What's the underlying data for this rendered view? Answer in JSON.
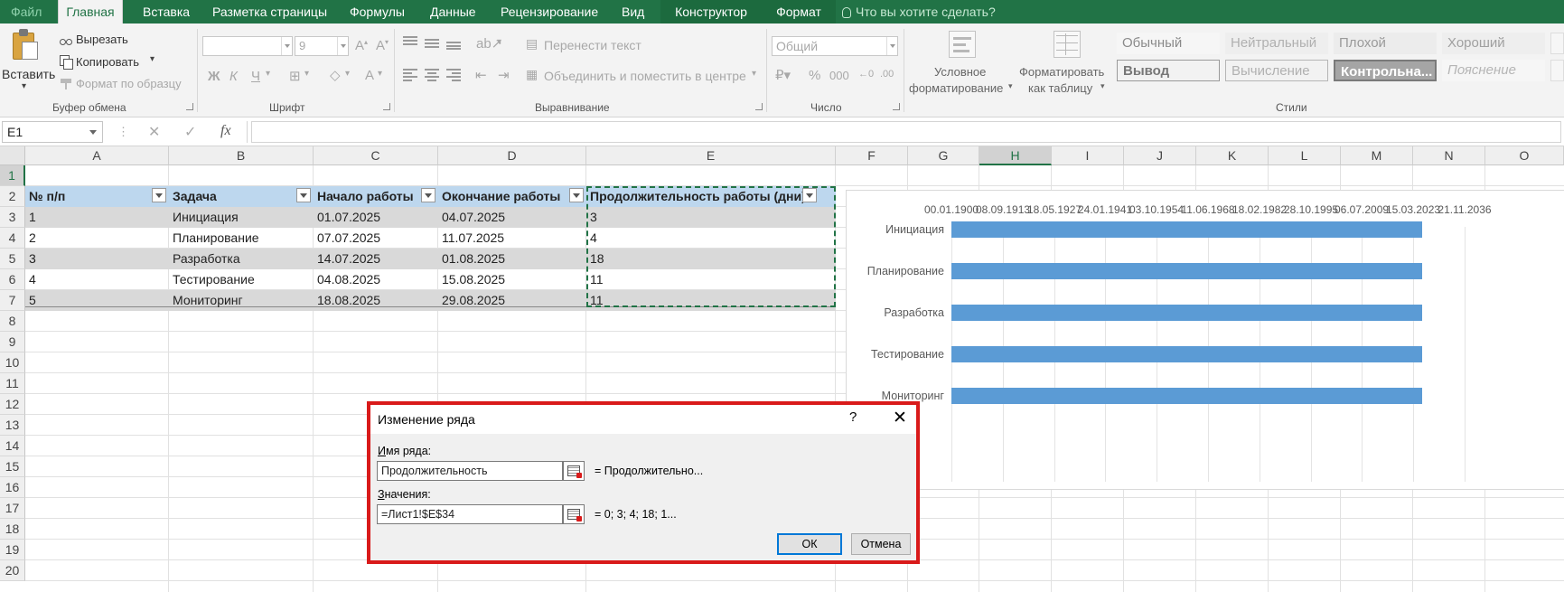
{
  "tabs": [
    {
      "label": "Файл",
      "kind": "file"
    },
    {
      "label": "Главная",
      "kind": "active"
    },
    {
      "label": "Вставка"
    },
    {
      "label": "Разметка страницы"
    },
    {
      "label": "Формулы"
    },
    {
      "label": "Данные"
    },
    {
      "label": "Рецензирование"
    },
    {
      "label": "Вид"
    },
    {
      "label": "Конструктор",
      "kind": "ctx"
    },
    {
      "label": "Формат",
      "kind": "ctx"
    },
    {
      "label": "Что вы хотите сделать?",
      "kind": "tell"
    }
  ],
  "ribbon": {
    "clipboard": {
      "paste": "Вставить",
      "cut": "Вырезать",
      "copy": "Копировать",
      "format_painter": "Формат по образцу",
      "title": "Буфер обмена"
    },
    "font": {
      "font_size": "9",
      "bold": "Ж",
      "italic": "К",
      "underline": "Ч",
      "title": "Шрифт"
    },
    "alignment": {
      "wrap": "Перенести текст",
      "merge": "Объединить и поместить в центре",
      "title": "Выравнивание"
    },
    "number": {
      "format": "Общий",
      "percent": "%",
      "title": "Число"
    },
    "styles": {
      "conditional_1": "Условное",
      "conditional_2": "форматирование",
      "table_1": "Форматировать",
      "table_2": "как таблицу",
      "cells": [
        "Обычный",
        "Нейтральный",
        "Плохой",
        "Хороший",
        "Вывод",
        "Вычисление",
        "Контрольна...",
        "Пояснение"
      ],
      "title": "Стили"
    }
  },
  "formula_bar": {
    "name_box": "E1",
    "fx": "fx",
    "cancel": "✕",
    "enter": "✓"
  },
  "columns": [
    "A",
    "B",
    "C",
    "D",
    "E",
    "F",
    "G",
    "H",
    "I",
    "J",
    "K",
    "L",
    "M",
    "N",
    "O"
  ],
  "rows": [
    "1",
    "2",
    "3",
    "4",
    "5",
    "6",
    "7",
    "8",
    "9",
    "10",
    "11",
    "12",
    "13",
    "14",
    "15",
    "16",
    "17",
    "18",
    "19",
    "20"
  ],
  "table": {
    "headers": [
      "№ п/п",
      "Задача",
      "Начало работы",
      "Окончание работы",
      "Продолжительность работы (дни)"
    ],
    "rows": [
      [
        "1",
        "Инициация",
        "01.07.2025",
        "04.07.2025",
        "3"
      ],
      [
        "2",
        "Планирование",
        "07.07.2025",
        "11.07.2025",
        "4"
      ],
      [
        "3",
        "Разработка",
        "14.07.2025",
        "01.08.2025",
        "18"
      ],
      [
        "4",
        "Тестирование",
        "04.08.2025",
        "15.08.2025",
        "11"
      ],
      [
        "5",
        "Мониторинг",
        "18.08.2025",
        "29.08.2025",
        "11"
      ]
    ]
  },
  "chart_data": {
    "type": "bar",
    "orientation": "horizontal",
    "x_tick_labels": [
      "00.01.1900",
      "08.09.1913",
      "18.05.1927",
      "24.01.1941",
      "03.10.1954",
      "11.06.1968",
      "18.02.1982",
      "28.10.1995",
      "06.07.2009",
      "15.03.2023",
      "21.11.2036"
    ],
    "categories": [
      "Инициация",
      "Планирование",
      "Разработка",
      "Тестирование",
      "Мониторинг"
    ],
    "values": [
      "01.07.2025",
      "07.07.2025",
      "14.07.2025",
      "04.08.2025",
      "18.08.2025"
    ],
    "xlim": [
      "00.01.1900",
      "21.11.2036"
    ],
    "grid": true,
    "bar_color": "#5b9bd5"
  },
  "dialog": {
    "title": "Изменение ряда",
    "help": "?",
    "close": "✕",
    "name_label_u": "И",
    "name_label_rest": "мя ряда:",
    "name_value": "Продолжительность",
    "name_preview": "= Продолжительно...",
    "values_label_u": "З",
    "values_label_rest": "начения:",
    "values_value": "=Лист1!$E$34",
    "values_preview": "= 0; 3; 4; 18; 1...",
    "ok": "ОК",
    "cancel": "Отмена"
  }
}
